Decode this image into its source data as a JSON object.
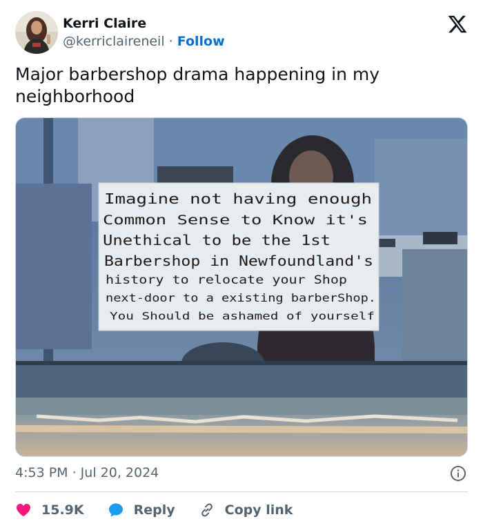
{
  "author": {
    "name": "Kerri Claire",
    "handle": "@kerriclaireneil",
    "separator": "·",
    "follow_label": "Follow"
  },
  "tweet": {
    "text": "Major barbershop drama happening in my neighborhood"
  },
  "sign": {
    "lines": [
      "Imagine not having enough",
      "Common Sense to Know it's",
      "Unethical to be the 1st",
      "Barbershop in Newfoundland's",
      "history to relocate your Shop",
      "next-door to a existing barberShop.",
      "You Should be ashamed of yourself"
    ]
  },
  "meta": {
    "timestamp": "4:53 PM · Jul 20, 2024"
  },
  "actions": {
    "like_count": "15.9K",
    "reply_label": "Reply",
    "copy_link_label": "Copy link"
  },
  "colors": {
    "like": "#f91880",
    "reply": "#1d9bf0",
    "follow": "#0b6fc7",
    "secondary_text": "#536471"
  },
  "icons": {
    "logo": "x-logo-icon",
    "info": "info-icon",
    "like": "heart-icon",
    "reply": "speech-bubble-icon",
    "copy_link": "link-icon"
  }
}
